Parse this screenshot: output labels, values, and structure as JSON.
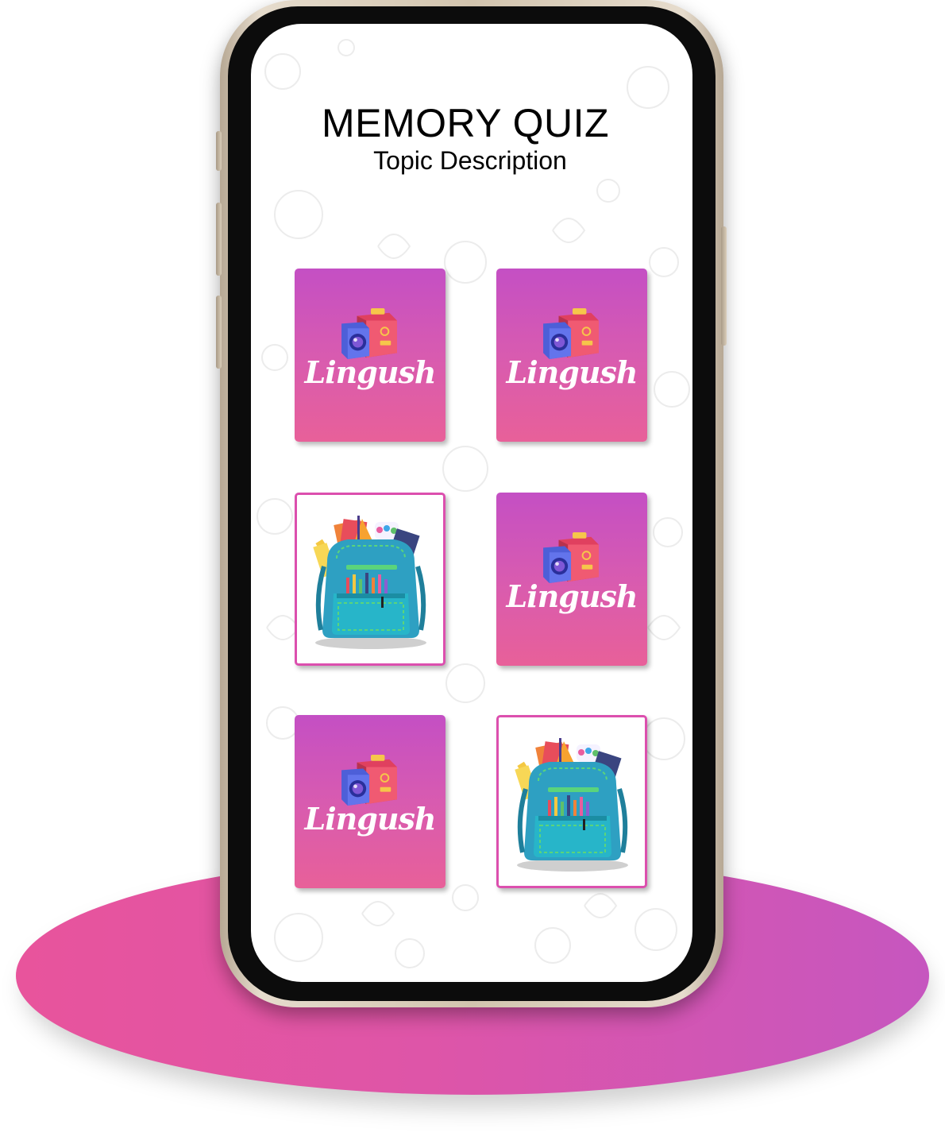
{
  "app": {
    "title": "MEMORY QUIZ",
    "subtitle": "Topic Description"
  },
  "cards": [
    {
      "state": "face-down",
      "logo_text": "Lingush"
    },
    {
      "state": "face-down",
      "logo_text": "Lingush"
    },
    {
      "state": "face-up",
      "image": "school-backpack"
    },
    {
      "state": "face-down",
      "logo_text": "Lingush"
    },
    {
      "state": "face-down",
      "logo_text": "Lingush"
    },
    {
      "state": "face-up",
      "image": "school-backpack"
    }
  ],
  "colors": {
    "card_back_top": "#c44fc4",
    "card_back_bottom": "#e86099",
    "card_front_border": "#dc4fae",
    "pedestal_left": "#e8549c",
    "pedestal_right": "#c656bf"
  },
  "icons": {
    "logo": "camera-box-icon",
    "card_image": "backpack-icon"
  }
}
